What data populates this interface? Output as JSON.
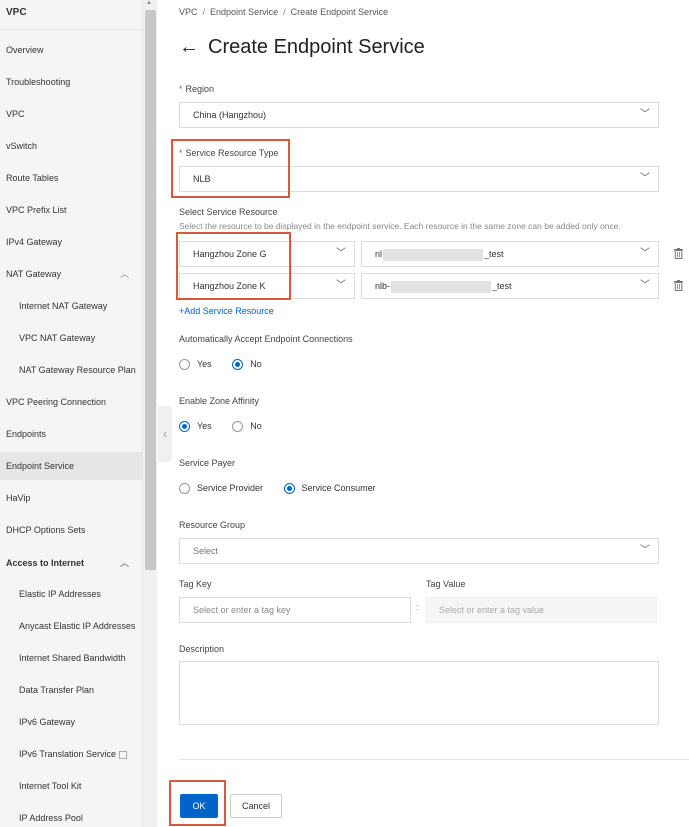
{
  "sidebar": {
    "title": "VPC",
    "items": [
      {
        "label": "Overview"
      },
      {
        "label": "Troubleshooting"
      },
      {
        "label": "VPC"
      },
      {
        "label": "vSwitch"
      },
      {
        "label": "Route Tables"
      },
      {
        "label": "VPC Prefix List"
      },
      {
        "label": "IPv4 Gateway"
      },
      {
        "label": "NAT Gateway"
      },
      {
        "label": "Internet NAT Gateway"
      },
      {
        "label": "VPC NAT Gateway"
      },
      {
        "label": "NAT Gateway Resource Plan"
      },
      {
        "label": "VPC Peering Connection"
      },
      {
        "label": "Endpoints"
      },
      {
        "label": "Endpoint Service"
      },
      {
        "label": "HaVip"
      },
      {
        "label": "DHCP Options Sets"
      },
      {
        "label": "Access to Internet"
      },
      {
        "label": "Elastic IP Addresses"
      },
      {
        "label": "Anycast Elastic IP Addresses"
      },
      {
        "label": "Internet Shared Bandwidth"
      },
      {
        "label": "Data Transfer Plan"
      },
      {
        "label": "IPv6 Gateway"
      },
      {
        "label": "IPv6 Translation Service"
      },
      {
        "label": "Internet Tool Kit"
      },
      {
        "label": "IP Address Pool"
      }
    ],
    "active": "Endpoint Service"
  },
  "breadcrumb": [
    "VPC",
    "Endpoint Service",
    "Create Endpoint Service"
  ],
  "page_title": "Create Endpoint Service",
  "form": {
    "region": {
      "label": "Region",
      "value": "China (Hangzhou)"
    },
    "resource_type": {
      "label": "Service Resource Type",
      "value": "NLB"
    },
    "service_resource": {
      "label": "Select Service Resource",
      "hint": "Select the resource to be displayed in the endpoint service. Each resource in the same zone can be added only once.",
      "rows": [
        {
          "zone": "Hangzhou Zone G",
          "prefix": "nl",
          "suffix": "_test"
        },
        {
          "zone": "Hangzhou Zone K",
          "prefix": "nlb-",
          "suffix": "_test"
        }
      ],
      "add_label": "+Add Service Resource"
    },
    "auto_accept": {
      "label": "Automatically Accept Endpoint Connections",
      "options": [
        "Yes",
        "No"
      ],
      "selected": "No"
    },
    "zone_affinity": {
      "label": "Enable Zone Affinity",
      "options": [
        "Yes",
        "No"
      ],
      "selected": "Yes"
    },
    "payer": {
      "label": "Service Payer",
      "options": [
        "Service Provider",
        "Service Consumer"
      ],
      "selected": "Service Consumer"
    },
    "resource_group": {
      "label": "Resource Group",
      "placeholder": "Select"
    },
    "tag_key": {
      "label": "Tag Key",
      "placeholder": "Select or enter a tag key"
    },
    "tag_sep": ":",
    "tag_value": {
      "label": "Tag Value",
      "placeholder": "Select or enter a tag value"
    },
    "description": {
      "label": "Description",
      "value": ""
    }
  },
  "actions": {
    "ok": "OK",
    "cancel": "Cancel"
  },
  "colors": {
    "primary": "#0064c8",
    "highlight_box": "#d85a3d",
    "required": "#e5432b"
  }
}
